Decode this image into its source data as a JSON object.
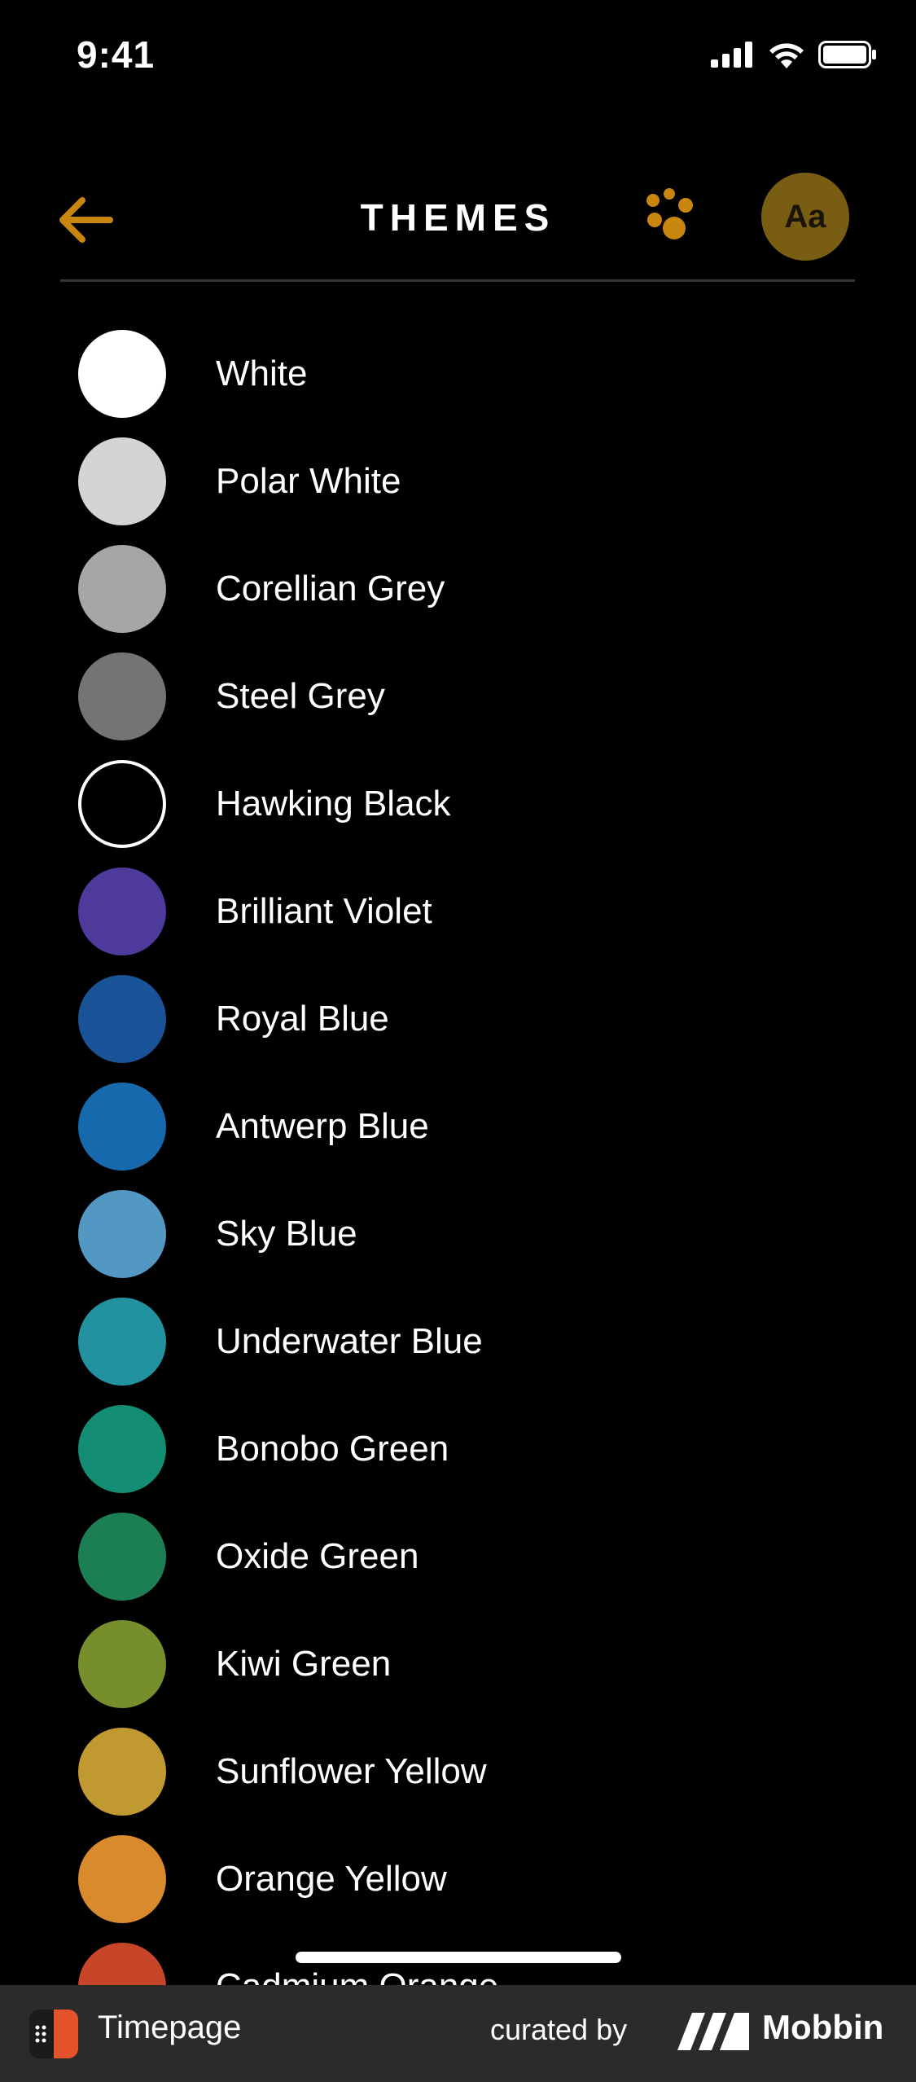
{
  "status_bar": {
    "time": "9:41"
  },
  "header": {
    "title": "THEMES",
    "font_button_label": "Aa"
  },
  "colors": {
    "accent": "#C8860E",
    "font_button_bg": "#7A5D14"
  },
  "themes": [
    {
      "label": "White",
      "color": "#FFFFFF"
    },
    {
      "label": "Polar White",
      "color": "#D4D4D4"
    },
    {
      "label": "Corellian Grey",
      "color": "#A6A6A6"
    },
    {
      "label": "Steel Grey",
      "color": "#747474"
    },
    {
      "label": "Hawking Black",
      "color": "#000000",
      "outlined": true
    },
    {
      "label": "Brilliant Violet",
      "color": "#4D3A9A"
    },
    {
      "label": "Royal Blue",
      "color": "#1A5398"
    },
    {
      "label": "Antwerp Blue",
      "color": "#1769AE"
    },
    {
      "label": "Sky Blue",
      "color": "#5298C3"
    },
    {
      "label": "Underwater Blue",
      "color": "#2292A0"
    },
    {
      "label": "Bonobo Green",
      "color": "#138D74"
    },
    {
      "label": "Oxide Green",
      "color": "#1C7F53"
    },
    {
      "label": "Kiwi Green",
      "color": "#778E2D"
    },
    {
      "label": "Sunflower Yellow",
      "color": "#C09A30"
    },
    {
      "label": "Orange Yellow",
      "color": "#D88A2C"
    },
    {
      "label": "Cadmium Orange",
      "color": "#C7462A"
    }
  ],
  "footer": {
    "app_name": "Timepage",
    "curated_by": "curated by",
    "brand": "Mobbin"
  }
}
